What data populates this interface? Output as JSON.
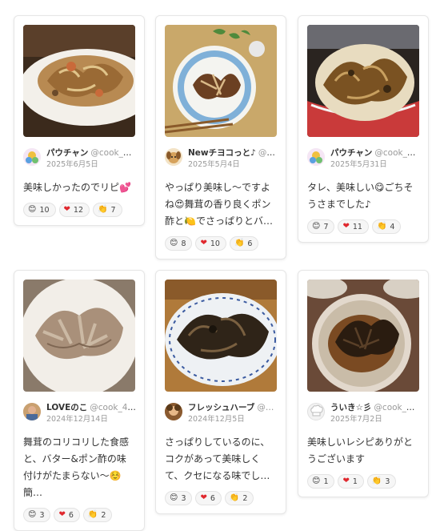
{
  "cards": [
    {
      "name": "パウチャン",
      "handle": "@cook_4…",
      "date": "2025年6月5日",
      "comment": "美味しかったのでリピ💕",
      "reactions": [
        {
          "icon": "smile-emoji",
          "count": "10"
        },
        {
          "icon": "heart-emoji",
          "count": "12"
        },
        {
          "icon": "clap-emoji",
          "count": "7"
        }
      ]
    },
    {
      "name": "Newチヨコっと♪",
      "handle": "@c…",
      "date": "2025年5月4日",
      "comment": "やっぱり美味し〜ですよね😍舞茸の香り良くポン酢と🍋でさっぱりとバ…",
      "reactions": [
        {
          "icon": "smile-emoji",
          "count": "8"
        },
        {
          "icon": "heart-emoji",
          "count": "10"
        },
        {
          "icon": "clap-emoji",
          "count": "6"
        }
      ]
    },
    {
      "name": "パウチャン",
      "handle": "@cook_4…",
      "date": "2025年5月31日",
      "comment": "タレ、美味しい😋ごちそうさまでした♪",
      "reactions": [
        {
          "icon": "smile-emoji",
          "count": "7"
        },
        {
          "icon": "heart-emoji",
          "count": "11"
        },
        {
          "icon": "clap-emoji",
          "count": "4"
        }
      ]
    },
    {
      "name": "LOVEのこ",
      "handle": "@cook_40…",
      "date": "2024年12月14日",
      "comment": "舞茸のコリコリした食感と、バター&ポン酢の味付けがたまらない〜☺️簡…",
      "reactions": [
        {
          "icon": "smile-emoji",
          "count": "3"
        },
        {
          "icon": "heart-emoji",
          "count": "6"
        },
        {
          "icon": "clap-emoji",
          "count": "2"
        }
      ]
    },
    {
      "name": "フレッシュハーブ",
      "handle": "@…",
      "date": "2024年12月5日",
      "comment": "さっぱりしているのに、コクがあって美味しくて、クセになる味でし…",
      "reactions": [
        {
          "icon": "smile-emoji",
          "count": "3"
        },
        {
          "icon": "heart-emoji",
          "count": "6"
        },
        {
          "icon": "clap-emoji",
          "count": "2"
        }
      ]
    },
    {
      "name": "ういき☆彡",
      "handle": "@cook_4…",
      "date": "2025年7月2日",
      "comment": "美味しいレシピありがとうございます",
      "reactions": [
        {
          "icon": "smile-emoji",
          "count": "1"
        },
        {
          "icon": "heart-emoji",
          "count": "1"
        },
        {
          "icon": "clap-emoji",
          "count": "3"
        }
      ]
    }
  ]
}
